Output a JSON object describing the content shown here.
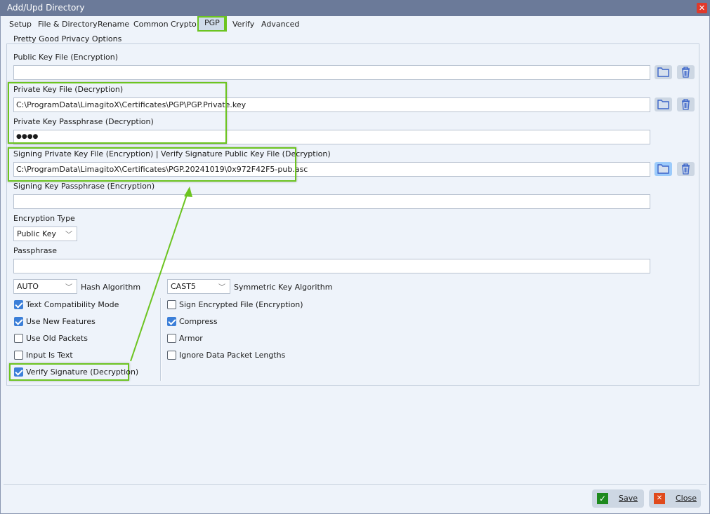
{
  "window": {
    "title": "Add/Upd Directory",
    "close_icon": "close-icon"
  },
  "tabs": [
    {
      "label": "Setup"
    },
    {
      "label": "File & Directory"
    },
    {
      "label": "Rename"
    },
    {
      "label": "Common"
    },
    {
      "label": "Crypto"
    },
    {
      "label": "PGP",
      "active": true
    },
    {
      "label": "Verify"
    },
    {
      "label": "Advanced"
    }
  ],
  "group": {
    "title": "Pretty Good Privacy Options"
  },
  "fields": {
    "public_key": {
      "label": "Public Key File (Encryption)",
      "value": ""
    },
    "private_key": {
      "label": "Private Key File (Decryption)",
      "value": "C:\\ProgramData\\LimagitoX\\Certificates\\PGP\\PGP.Private.key"
    },
    "private_pass": {
      "label": "Private Key Passphrase (Decryption)",
      "value": "●●●●"
    },
    "signing_key": {
      "label": "Signing Private Key File (Encryption) | Verify Signature Public Key File (Decryption)",
      "value": "C:\\ProgramData\\LimagitoX\\Certificates\\PGP.20241019\\0x972F42F5-pub.asc"
    },
    "signing_pass": {
      "label": "Signing Key Passphrase (Encryption)",
      "value": ""
    },
    "encryption_type": {
      "label": "Encryption Type",
      "value": "Public Key"
    },
    "passphrase": {
      "label": "Passphrase",
      "value": ""
    },
    "hash": {
      "label": "Hash Algorithm",
      "value": "AUTO"
    },
    "symmetric": {
      "label": "Symmetric Key Algorithm",
      "value": "CAST5"
    }
  },
  "checkboxes_left": [
    {
      "label": "Text Compatibility Mode",
      "checked": true
    },
    {
      "label": "Use New Features",
      "checked": true
    },
    {
      "label": "Use Old Packets",
      "checked": false
    },
    {
      "label": "Input Is Text",
      "checked": false
    },
    {
      "label": "Verify Signature (Decryption)",
      "checked": true
    }
  ],
  "checkboxes_right": [
    {
      "label": "Sign Encrypted File (Encryption)",
      "checked": false
    },
    {
      "label": "Compress",
      "checked": true
    },
    {
      "label": "Armor",
      "checked": false
    },
    {
      "label": "Ignore Data Packet Lengths",
      "checked": false
    }
  ],
  "buttons": {
    "save": "Save",
    "close": "Close"
  },
  "colors": {
    "titlebar": "#6b7a99",
    "highlight": "#6cc420",
    "save": "#1e8a1e",
    "close": "#e04a1c"
  }
}
